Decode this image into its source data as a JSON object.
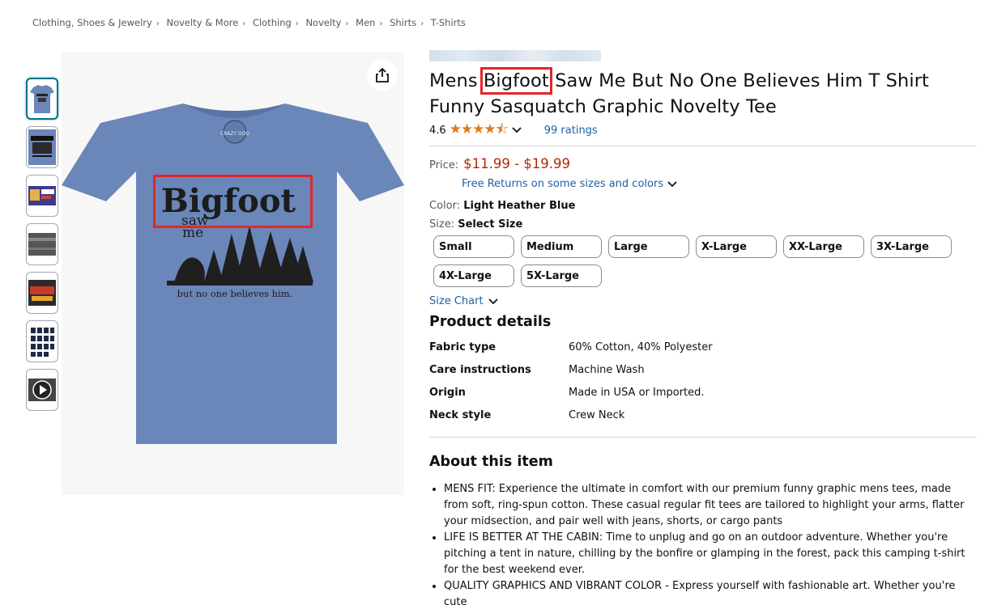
{
  "breadcrumb": [
    "Clothing, Shoes & Jewelry",
    "Novelty & More",
    "Clothing",
    "Novelty",
    "Men",
    "Shirts",
    "T-Shirts"
  ],
  "breadcrumb_separator": "›",
  "product": {
    "title": "Mens Bigfoot Saw Me But No One Believes Him T Shirt Funny Sasquatch Graphic Novelty Tee",
    "title_before": "Mens ",
    "title_highlight": "Bigfoot",
    "title_after": " Saw Me But No One Believes Him T Shirt Funny Sasquatch Graphic Novelty Tee",
    "rating": "4.6",
    "stars": "★★★★⯪",
    "ratings_count": "99 ratings",
    "price_label": "Price:",
    "price": "$11.99 - $19.99",
    "returns": "Free Returns on some sizes and colors",
    "color_label": "Color:",
    "color_value": "Light Heather Blue",
    "size_label": "Size:",
    "size_value": "Select Size",
    "sizes": [
      "Small",
      "Medium",
      "Large",
      "X-Large",
      "XX-Large",
      "3X-Large",
      "4X-Large",
      "5X-Large"
    ],
    "size_chart": "Size Chart"
  },
  "shirt": {
    "print_big": "Bigfoot",
    "print_saw": "saw",
    "print_me": "me",
    "print_bottom": "but no one believes him.",
    "badge": "CRAZY DOG",
    "color": "#6b86b8"
  },
  "details_heading": "Product details",
  "details": [
    {
      "k": "Fabric type",
      "v": "60% Cotton, 40% Polyester"
    },
    {
      "k": "Care instructions",
      "v": "Machine Wash"
    },
    {
      "k": "Origin",
      "v": "Made in USA or Imported."
    },
    {
      "k": "Neck style",
      "v": "Crew Neck"
    }
  ],
  "about_heading": "About this item",
  "bullets": [
    "MENS FIT: Experience the ultimate in comfort with our premium funny graphic mens tees, made from soft, ring-spun cotton. These casual regular fit tees are tailored to highlight your arms, flatter your midsection, and pair well with jeans, shorts, or cargo pants",
    "LIFE IS BETTER AT THE CABIN: Time to unplug and go on an outdoor adventure. Whether you're pitching a tent in nature, chilling by the bonfire or glamping in the forest, pack this camping t-shirt for the best weekend ever.",
    "QUALITY GRAPHICS AND VIBRANT COLOR - Express yourself with fashionable art. Whether you're cute"
  ],
  "colors": {
    "link": "#2162a1",
    "price": "#b12704",
    "star": "#de7921",
    "highlight": "#e3262b"
  },
  "icons": [
    "share-icon",
    "chevron-down-icon",
    "play-icon"
  ]
}
